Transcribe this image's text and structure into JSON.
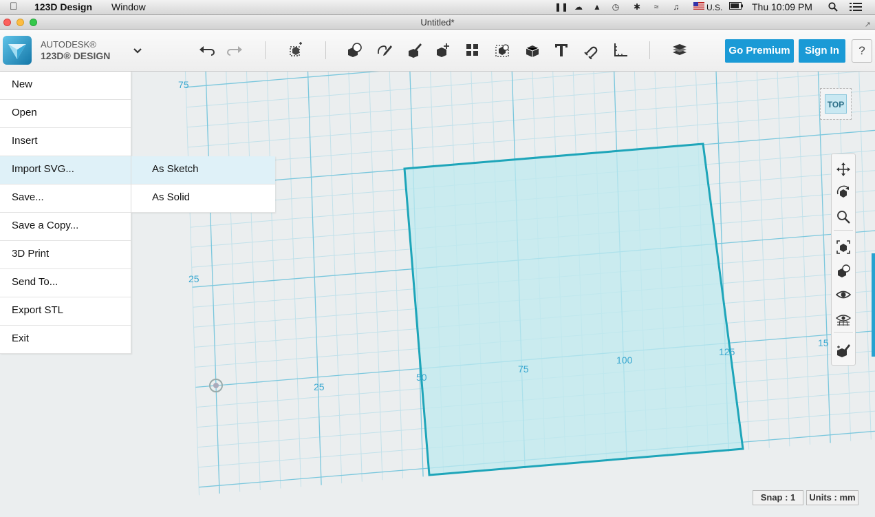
{
  "menubar": {
    "app_name": "123D Design",
    "window_menu": "Window",
    "locale": "U.S.",
    "clock": "Thu 10:09 PM"
  },
  "window": {
    "title": "Untitled*"
  },
  "brand": {
    "line1": "AUTODESK®",
    "line2": "123D® DESIGN"
  },
  "toolbar": {
    "tools": [
      "undo-icon",
      "redo-icon",
      "transform-icon",
      "primitives-icon",
      "sketch-icon",
      "construct-icon",
      "modify-icon",
      "pattern-icon",
      "grouping-icon",
      "combine-icon",
      "text-icon",
      "snap-icon",
      "measure-icon",
      "material-icon"
    ],
    "go_premium": "Go Premium",
    "sign_in": "Sign In",
    "help": "?"
  },
  "file_menu": {
    "items": [
      "New",
      "Open",
      "Insert",
      "Import SVG...",
      "Save...",
      "Save a Copy...",
      "3D Print",
      "Send To...",
      "Export STL",
      "Exit"
    ],
    "active_index": 3
  },
  "submenu": {
    "items": [
      "As Sketch",
      "As Solid"
    ],
    "active_index": 0
  },
  "viewcube": {
    "face_label": "TOP"
  },
  "grid_labels": {
    "y75": "75",
    "y25": "25",
    "x25": "25",
    "x50": "50",
    "x75": "75",
    "x100": "100",
    "x125": "125",
    "x150": "15"
  },
  "status": {
    "snap": "Snap : 1",
    "units": "Units : mm"
  },
  "colors": {
    "accent": "#1a9ad6",
    "grid_major": "#79c5dc",
    "grid_minor": "#b9dde8",
    "shape_fill": "#bfe9ee",
    "shape_stroke": "#1fa3b8"
  }
}
